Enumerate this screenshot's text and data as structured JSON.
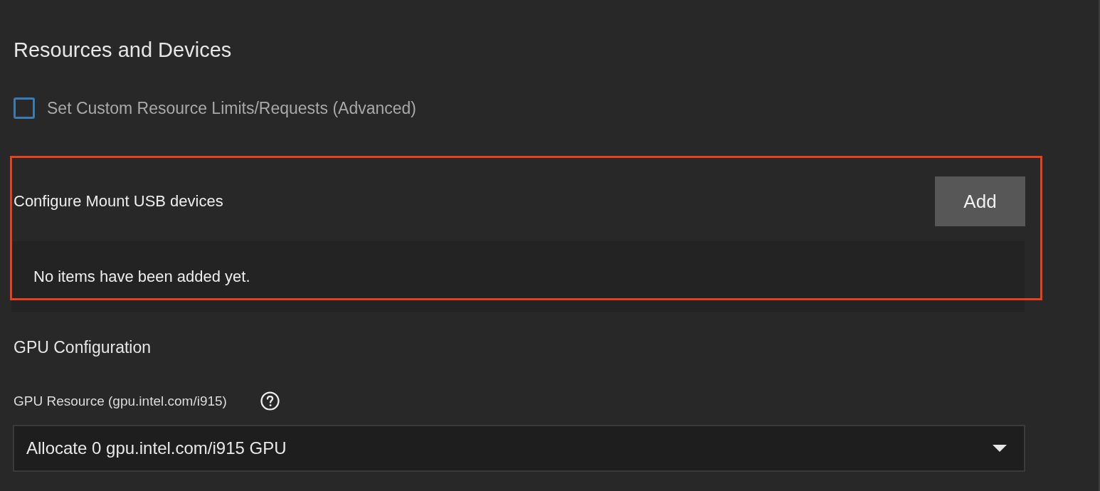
{
  "section": {
    "title": "Resources and Devices"
  },
  "custom_limits": {
    "label": "Set Custom Resource Limits/Requests (Advanced)",
    "checked": false
  },
  "usb_devices": {
    "label": "Configure Mount USB devices",
    "add_button": "Add",
    "empty_message": "No items have been added yet."
  },
  "gpu": {
    "heading": "GPU Configuration",
    "field_label": "GPU Resource (gpu.intel.com/i915)",
    "select_value": "Allocate 0 gpu.intel.com/i915 GPU"
  }
}
